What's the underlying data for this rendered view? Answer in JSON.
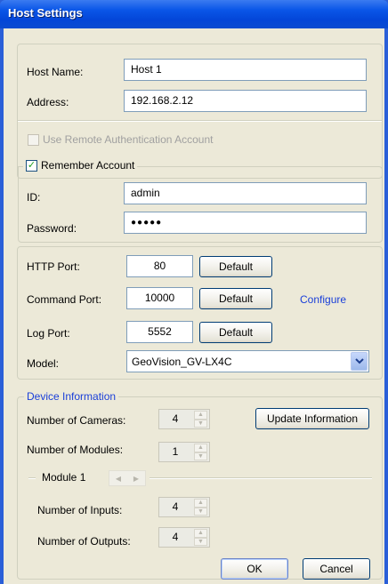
{
  "window": {
    "title": "Host Settings"
  },
  "host": {
    "name_label": "Host Name:",
    "name_value": "Host 1",
    "address_label": "Address:",
    "address_value": "192.168.2.12"
  },
  "remote_auth": {
    "label": "Use Remote Authentication Account",
    "checked": false,
    "enabled": false
  },
  "account": {
    "remember_label": "Remember Account",
    "remember_checked": true,
    "id_label": "ID:",
    "id_value": "admin",
    "password_label": "Password:",
    "password_value": "●●●●●"
  },
  "ports": {
    "http_label": "HTTP Port:",
    "http_value": "80",
    "command_label": "Command Port:",
    "command_value": "10000",
    "log_label": "Log Port:",
    "log_value": "5552",
    "default_label": "Default",
    "configure_label": "Configure"
  },
  "model": {
    "label": "Model:",
    "value": "GeoVision_GV-LX4C"
  },
  "device_info": {
    "title": "Device Information",
    "cameras_label": "Number of Cameras:",
    "cameras_value": "4",
    "modules_label": "Number of Modules:",
    "modules_value": "1",
    "update_label": "Update Information"
  },
  "module": {
    "title": "Module 1",
    "inputs_label": "Number of Inputs:",
    "inputs_value": "4",
    "outputs_label": "Number of Outputs:",
    "outputs_value": "4"
  },
  "dialog_buttons": {
    "ok": "OK",
    "cancel": "Cancel"
  },
  "colors": {
    "titlebar": "#0346d8",
    "link": "#1a3fd9",
    "check": "#21a121"
  }
}
